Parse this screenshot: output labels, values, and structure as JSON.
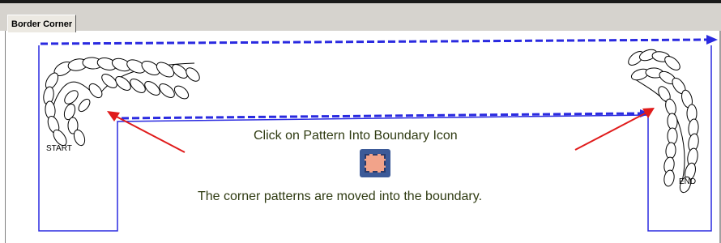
{
  "tab": {
    "label": "Border Corner"
  },
  "instructions": {
    "line1": "Click on Pattern Into Boundary Icon",
    "line2": "The corner patterns are moved into the boundary."
  },
  "labels": {
    "start": "START",
    "end": "END"
  },
  "icons": {
    "pattern_into_boundary": "pattern-into-boundary-icon"
  },
  "colors": {
    "boundary": "#2a2ae0",
    "arrow": "#e01b1b",
    "text": "#2f3b12"
  }
}
